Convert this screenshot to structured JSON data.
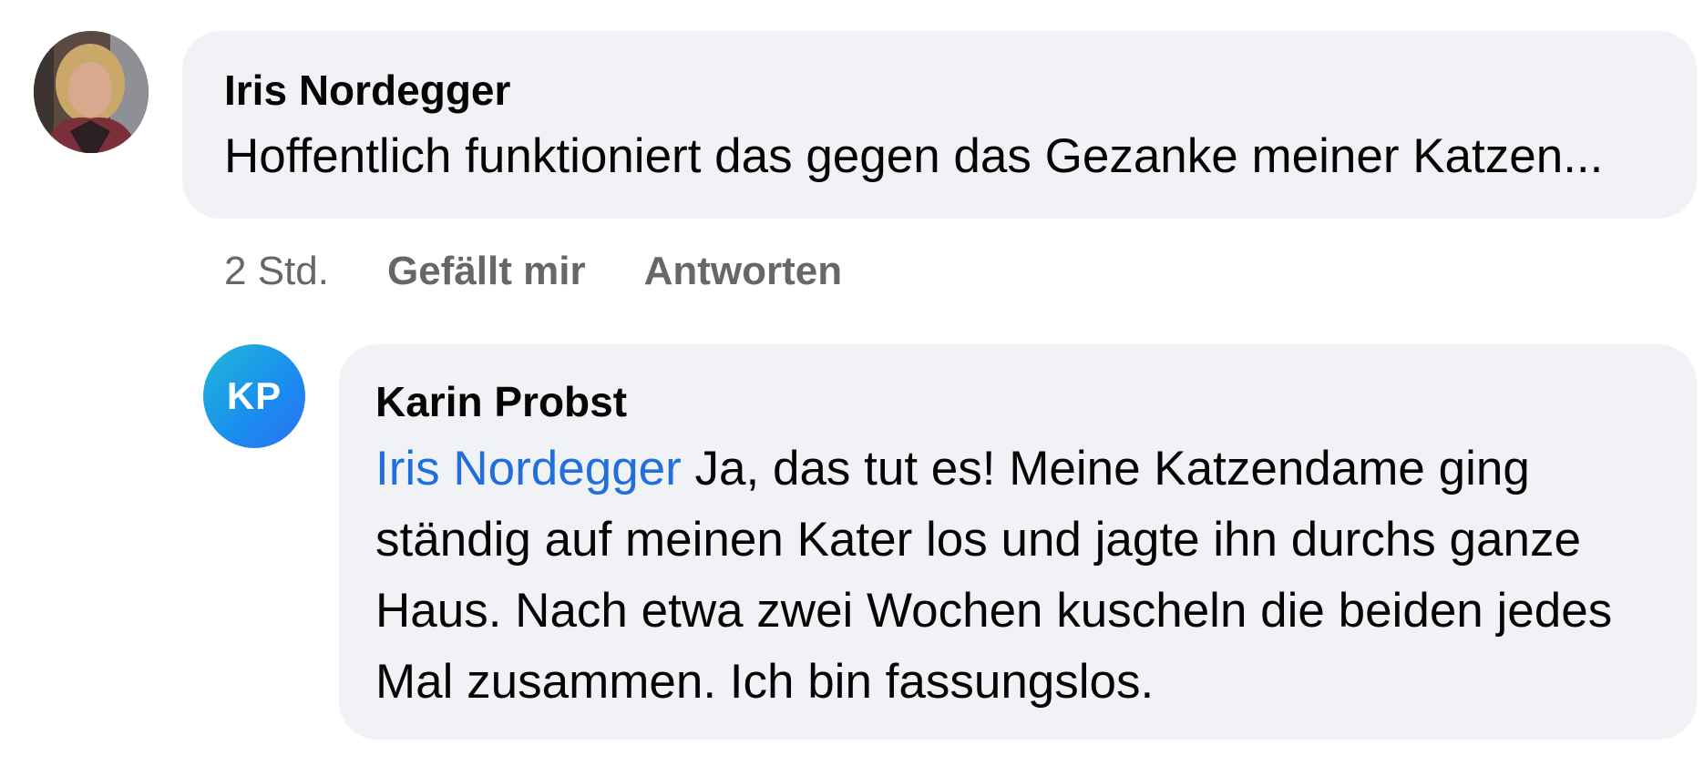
{
  "comments": [
    {
      "author": "Iris Nordegger",
      "avatar_icon": "profile-photo-avatar",
      "text": "Hoffentlich funktioniert das gegen das Gezanke meiner Katzen...",
      "actions": {
        "timestamp": "2 Std.",
        "like_label": "Gefällt mir",
        "reply_label": "Antworten"
      }
    }
  ],
  "reply": {
    "author": "Karin Probst",
    "avatar_initials": "KP",
    "mention": "Iris Nordegger",
    "text": " Ja, das tut es! Meine Katzendame ging ständig auf meinen Kater los und jagte ihn durchs ganze Haus. Nach etwa zwei Wochen kuscheln die beiden jedes Mal zusammen. Ich bin fassungslos."
  },
  "colors": {
    "bubble_background": "#f0f2f5",
    "mention_link": "#216fdb",
    "meta_text": "#65676b",
    "avatar_gradient_start": "#1fb8d8",
    "avatar_gradient_end": "#2f6ff0"
  }
}
